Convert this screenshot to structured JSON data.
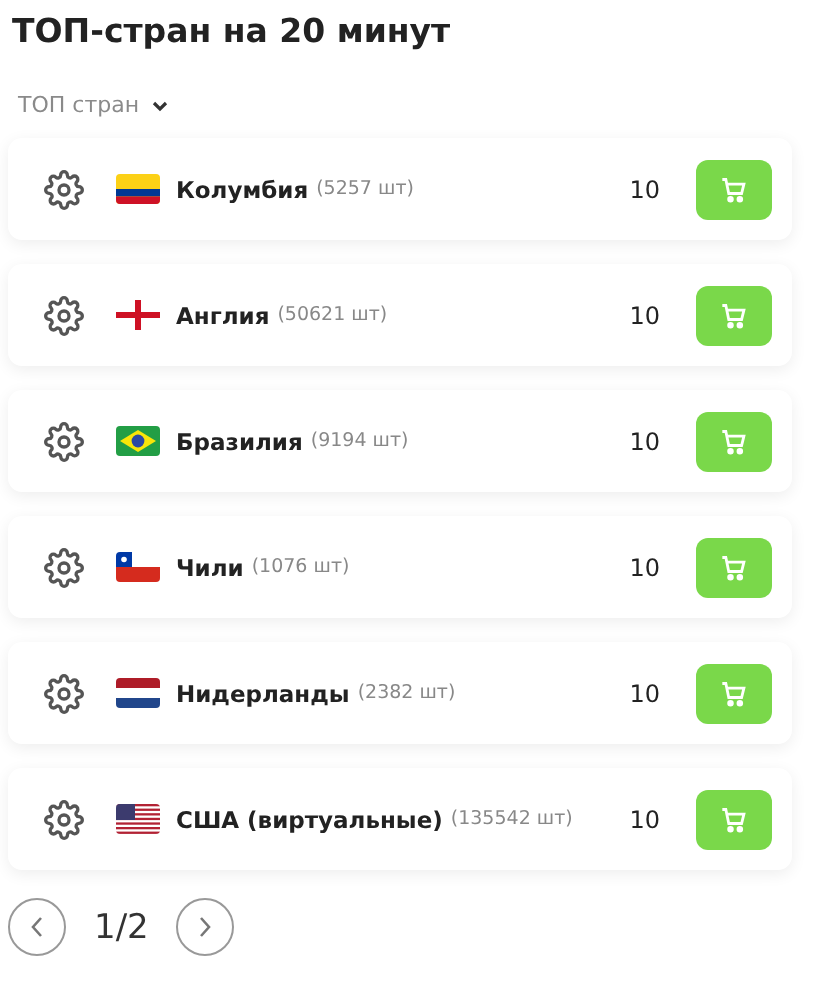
{
  "title": "ТОП-стран на 20 минут",
  "filter": {
    "label": "ТОП стран"
  },
  "countries": [
    {
      "kind": "colombia",
      "name": "Колумбия",
      "count": "(5257 шт)",
      "price": "10"
    },
    {
      "kind": "england",
      "name": "Англия",
      "count": "(50621 шт)",
      "price": "10"
    },
    {
      "kind": "brazil",
      "name": "Бразилия",
      "count": "(9194 шт)",
      "price": "10"
    },
    {
      "kind": "chile",
      "name": "Чили",
      "count": "(1076 шт)",
      "price": "10"
    },
    {
      "kind": "netherlands",
      "name": "Нидерланды",
      "count": "(2382 шт)",
      "price": "10"
    },
    {
      "kind": "usa",
      "name": "США (виртуальные)",
      "count": "(135542 шт)",
      "price": "10"
    }
  ],
  "pagination": {
    "page": "1/2"
  }
}
